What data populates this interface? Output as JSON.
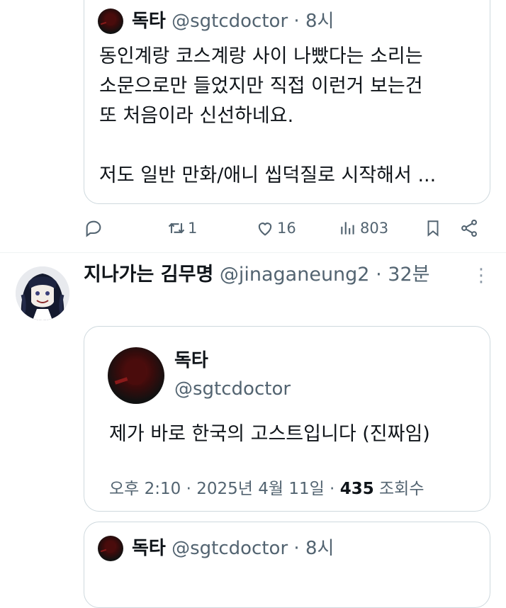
{
  "tweet1": {
    "author": "독타",
    "handle": "@sgtcdoctor",
    "separator": "·",
    "time": "8시",
    "lines": [
      "동인계랑 코스계랑 사이 나빴다는 소리는",
      "소문으로만 들었지만 직접 이런거 보는건",
      "또 처음이라 신선하네요.",
      "저도 일반 만화/애니 씹덕질로 시작해서 ..."
    ]
  },
  "actions": {
    "reply_icon": "reply-icon",
    "retweet_count": "1",
    "like_count": "16",
    "views_count": "803"
  },
  "tweet2": {
    "author": "지나가는 김무명",
    "handle": "@jinaganeung2",
    "separator": "·",
    "time": "32분",
    "more": "⋮"
  },
  "quoted": {
    "author": "독타",
    "handle": "@sgtcdoctor",
    "text": "제가 바로 한국의 고스트입니다 (진짜임)",
    "meta_time": "오후 2:10 · 2025년 4월 11일 ·",
    "meta_views": "435",
    "meta_views_label": "조회수"
  },
  "tweet3": {
    "author": "독타",
    "handle": "@sgtcdoctor",
    "separator": "·",
    "time": "8시"
  },
  "colors": {
    "text": "#0f1419",
    "secondary": "#536471",
    "border": "#cfd9de"
  }
}
